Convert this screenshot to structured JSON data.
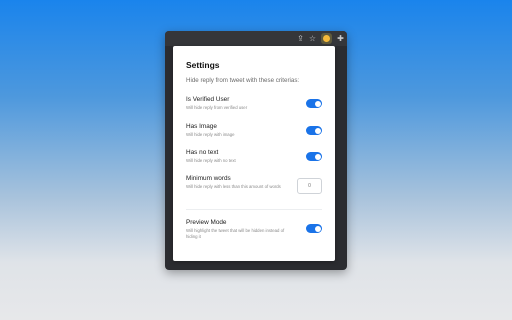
{
  "browser": {
    "toolbar_icons": [
      "share-icon",
      "star-icon",
      "extension-icon",
      "puzzle-icon"
    ],
    "share_glyph": "⇪",
    "star_glyph": "☆",
    "puzzle_glyph": "✚"
  },
  "popup": {
    "title": "Settings",
    "subtitle": "Hide reply from tweet with these criterias:",
    "settings": [
      {
        "label": "Is Verified User",
        "description": "Will hide reply from verified user",
        "enabled": true
      },
      {
        "label": "Has Image",
        "description": "Will hide reply with image",
        "enabled": true
      },
      {
        "label": "Has no text",
        "description": "Will hide reply with no text",
        "enabled": true
      }
    ],
    "minimum_words": {
      "label": "Minimum words",
      "description": "Will hide reply with less than this amount of words",
      "value": "0"
    },
    "preview_mode": {
      "label": "Preview Mode",
      "description": "Will highlight the tweet that will be hidden instead of hiding it",
      "enabled": true
    }
  },
  "colors": {
    "accent": "#1a73e8",
    "background_top": "#1a84ec",
    "background_bottom": "#e7e8ea"
  }
}
